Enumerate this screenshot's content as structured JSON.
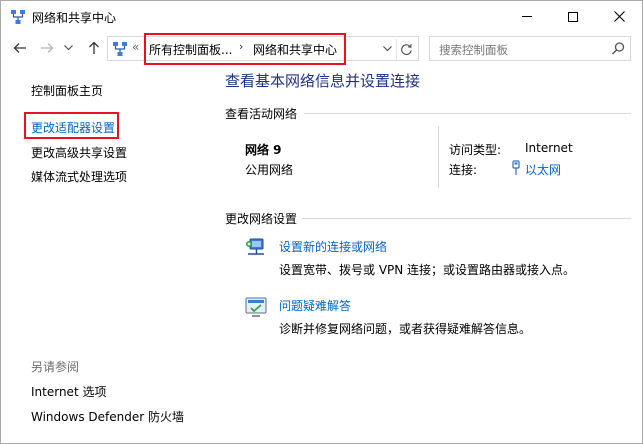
{
  "window": {
    "title": "网络和共享中心"
  },
  "nav": {
    "back_icon": "arrow-left-icon",
    "forward_icon": "arrow-right-icon",
    "recent_icon": "chevron-down-icon",
    "up_icon": "arrow-up-icon"
  },
  "address": {
    "overflow": "«",
    "crumb1": "所有控制面板...",
    "separator": "›",
    "crumb2": "网络和共享中心"
  },
  "search": {
    "placeholder": "搜索控制面板"
  },
  "sidebar": {
    "home": "控制面板主页",
    "adapter": "更改适配器设置",
    "sharing": "更改高级共享设置",
    "media": "媒体流式处理选项",
    "see_also": "另请参阅",
    "internet_options": "Internet 选项",
    "firewall": "Windows Defender 防火墙"
  },
  "main": {
    "title": "查看基本网络信息并设置连接",
    "active_section": "查看活动网络",
    "network_name": "网络 9",
    "network_category": "公用网络",
    "access_label": "访问类型:",
    "access_value": "Internet",
    "connection_label": "连接:",
    "connection_value": "以太网",
    "change_section": "更改网络设置",
    "task1_link": "设置新的连接或网络",
    "task1_desc": "设置宽带、拨号或 VPN 连接；或设置路由器或接入点。",
    "task2_link": "问题疑难解答",
    "task2_desc": "诊断并修复网络问题，或者获得疑难解答信息。"
  },
  "colors": {
    "link": "#0066cc",
    "heading": "#1e3287",
    "highlight": "#e81123"
  }
}
